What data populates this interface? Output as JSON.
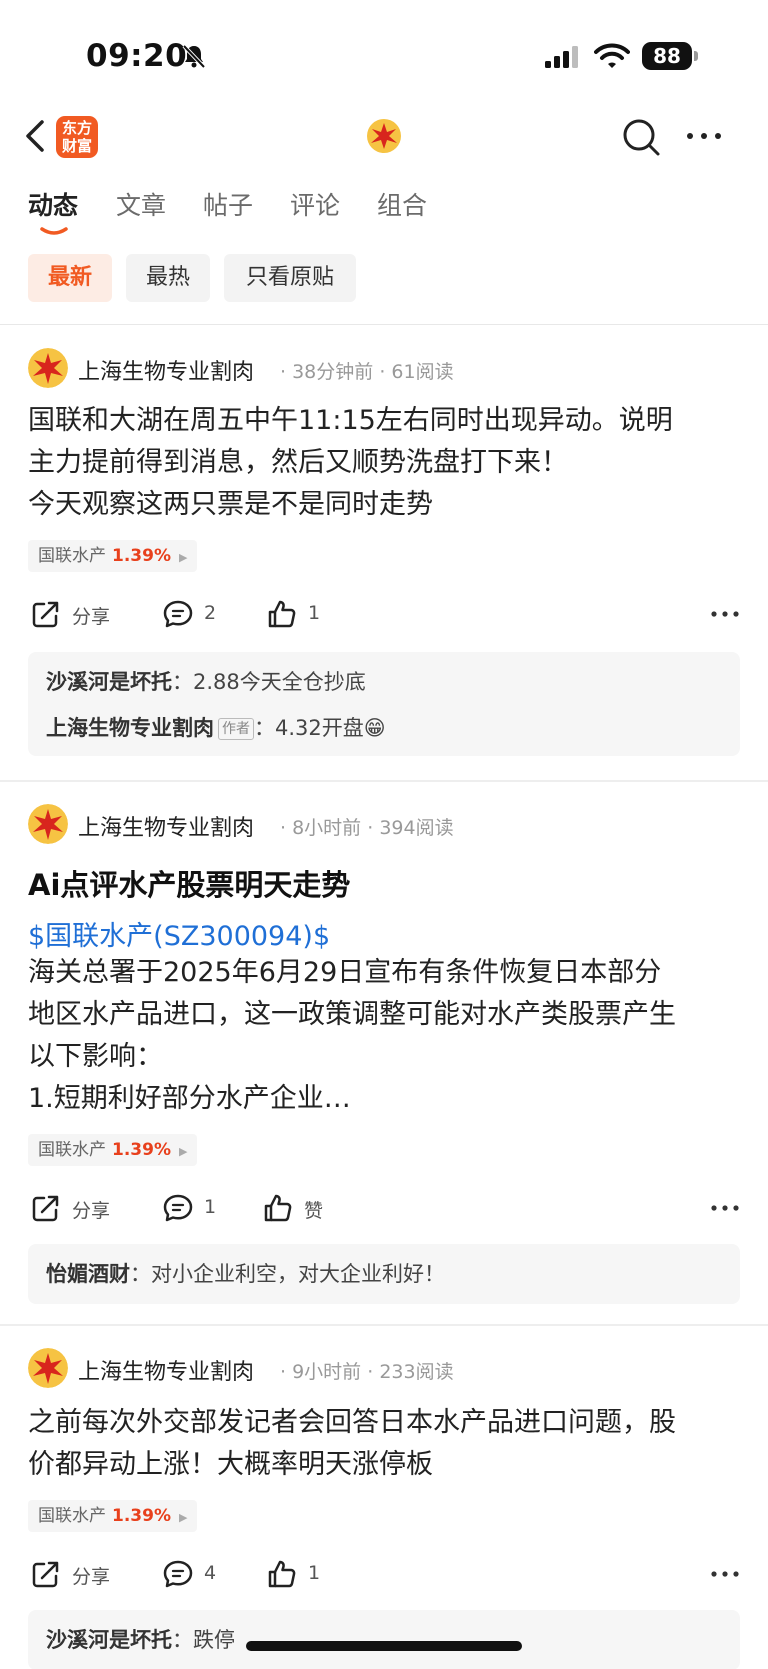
{
  "status_bar": {
    "time": "09:20",
    "battery": "88"
  },
  "nav": {
    "brand_line1": "东方",
    "brand_line2": "财富"
  },
  "tabs": [
    {
      "label": "动态",
      "active": true
    },
    {
      "label": "文章"
    },
    {
      "label": "帖子"
    },
    {
      "label": "评论"
    },
    {
      "label": "组合"
    }
  ],
  "filters": [
    {
      "label": "最新",
      "active": true
    },
    {
      "label": "最热"
    },
    {
      "label": "只看原贴"
    }
  ],
  "accent_color": "#f15a22",
  "up_color": "#e8401c",
  "link_color": "#1f6fd6",
  "posts": [
    {
      "author": "上海生物专业割肉",
      "time": "38分钟前",
      "reads": "61阅读",
      "body_lines": [
        "国联和大湖在周五中午11:15左右同时出现异动。说明",
        "主力提前得到消息，然后又顺势洗盘打下来！",
        "今天观察这两只票是不是同时走势"
      ],
      "stock": {
        "name": "国联水产",
        "change": "1.39%"
      },
      "share_label": "分享",
      "comment_count": "2",
      "like_label": "1",
      "comments": [
        {
          "user": "沙溪河是坏托",
          "text": "2.88今天全仓抄底"
        },
        {
          "user": "上海生物专业割肉",
          "badge": "作者",
          "text": "4.32开盘😁"
        }
      ]
    },
    {
      "author": "上海生物专业割肉",
      "time": "8小时前",
      "reads": "394阅读",
      "title": "Ai点评水产股票明天走势",
      "link": "$国联水产(SZ300094)$",
      "body_lines": [
        "海关总署于2025年6月29日宣布有条件恢复日本部分",
        "地区水产品进口，这一政策调整可能对水产类股票产生",
        "以下影响：",
        "1.短期利好部分水产企业…"
      ],
      "stock": {
        "name": "国联水产",
        "change": "1.39%"
      },
      "share_label": "分享",
      "comment_count": "1",
      "like_label": "赞",
      "comments": [
        {
          "user": "怡媚酒财",
          "text": "对小企业利空，对大企业利好！"
        }
      ]
    },
    {
      "author": "上海生物专业割肉",
      "time": "9小时前",
      "reads": "233阅读",
      "body_lines": [
        "之前每次外交部发记者会回答日本水产品进口问题，股",
        "价都异动上涨！大概率明天涨停板"
      ],
      "stock": {
        "name": "国联水产",
        "change": "1.39%"
      },
      "share_label": "分享",
      "comment_count": "4",
      "like_label": "1",
      "comments": [
        {
          "user": "沙溪河是坏托",
          "text": "跌停"
        }
      ]
    }
  ]
}
